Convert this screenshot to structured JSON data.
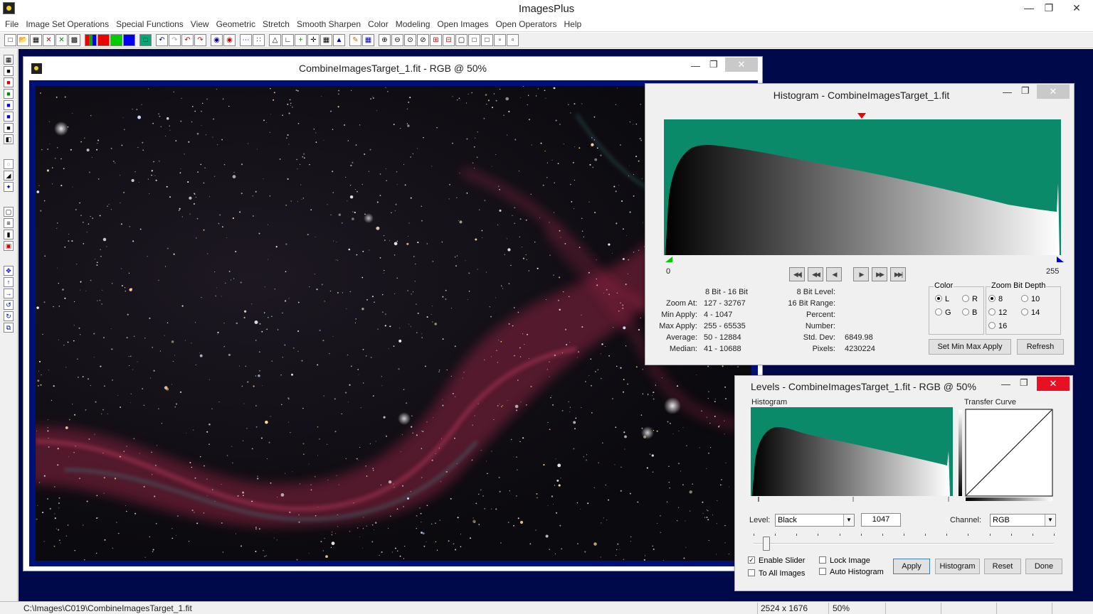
{
  "app": {
    "title": "ImagesPlus"
  },
  "menu": [
    "File",
    "Image Set Operations",
    "Special Functions",
    "View",
    "Geometric",
    "Stretch",
    "Smooth Sharpen",
    "Color",
    "Modeling",
    "Open Images",
    "Open Operators",
    "Help"
  ],
  "image_window": {
    "title": "CombineImagesTarget_1.fit - RGB @ 50%"
  },
  "histogram_window": {
    "title": "Histogram - CombineImagesTarget_1.fit",
    "axis_min": "0",
    "axis_max": "255",
    "header_bits": "8 Bit - 16 Bit",
    "stats_left": [
      {
        "label": "Zoom At:",
        "value": "127 - 32767"
      },
      {
        "label": "Min Apply:",
        "value": "4 - 1047"
      },
      {
        "label": "Max Apply:",
        "value": "255 - 65535"
      },
      {
        "label": "Average:",
        "value": "50 - 12884"
      },
      {
        "label": "Median:",
        "value": "41 - 10688"
      }
    ],
    "stats_right": [
      {
        "label": "8 Bit Level:",
        "value": ""
      },
      {
        "label": "16 Bit Range:",
        "value": ""
      },
      {
        "label": "Percent:",
        "value": ""
      },
      {
        "label": "Number:",
        "value": ""
      },
      {
        "label": "Std. Dev:",
        "value": "6849.98"
      },
      {
        "label": "Pixels:",
        "value": "4230224"
      }
    ],
    "color_group": {
      "label": "Color",
      "options": [
        "L",
        "R",
        "G",
        "B"
      ],
      "selected": "L"
    },
    "zoom_group": {
      "label": "Zoom Bit Depth",
      "options": [
        "8",
        "10",
        "12",
        "14",
        "16"
      ],
      "selected": "8"
    },
    "buttons": {
      "set_min_max": "Set Min Max Apply",
      "refresh": "Refresh"
    }
  },
  "levels_window": {
    "title": "Levels - CombineImagesTarget_1.fit - RGB @ 50%",
    "histogram_label": "Histogram",
    "curve_label": "Transfer Curve",
    "level_label": "Level:",
    "level_value": "Black",
    "level_number": "1047",
    "channel_label": "Channel:",
    "channel_value": "RGB",
    "slider_value": 0.03,
    "checks": [
      {
        "label": "Enable Slider",
        "checked": true
      },
      {
        "label": "To All Images",
        "checked": false
      },
      {
        "label": "Lock Image",
        "checked": false
      },
      {
        "label": "Auto Histogram",
        "checked": false
      }
    ],
    "buttons": {
      "apply": "Apply",
      "histogram": "Histogram",
      "reset": "Reset",
      "done": "Done"
    }
  },
  "status": {
    "path": "C:\\Images\\C019\\CombineImagesTarget_1.fit",
    "size": "2524 x 1676",
    "zoom": "50%"
  },
  "colors": {
    "histogram_bg": "#0b8a6a",
    "workspace": "#000a4a",
    "close_red": "#e81123"
  }
}
